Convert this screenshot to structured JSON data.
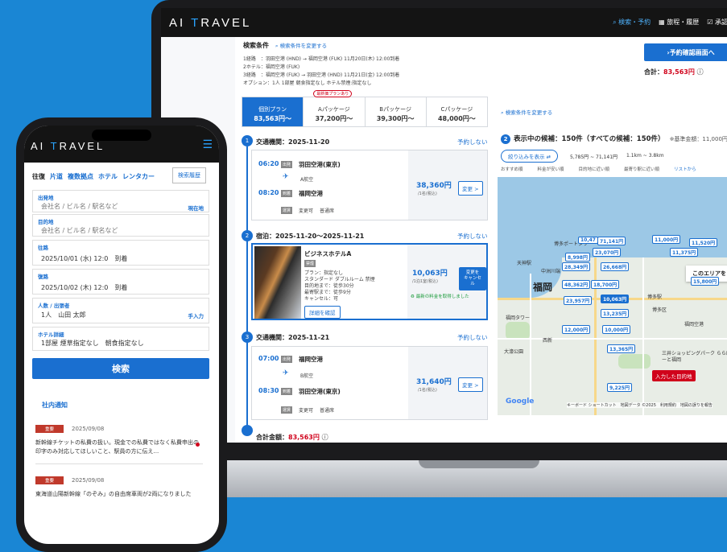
{
  "brand": {
    "name_prefix": "AI ",
    "name_t": "T",
    "name_suffix": "RAVEL"
  },
  "laptop": {
    "nav": [
      {
        "label": "検索・予約"
      },
      {
        "label": "旅程・履歴"
      },
      {
        "label": "承認"
      }
    ],
    "criteria": {
      "title": "検索条件",
      "change_link": "検索条件を変更する",
      "lines": [
        "1経路　：羽田空港 (HND) → 福岡空港 (FUK) 11月20日(木) 12:00到着",
        "2ホテル：福岡空港 (FUK)",
        "3経路　：福岡空港 (FUK) → 羽田空港 (HND) 11月21日(金) 12:00到着",
        "オプション：1人 1部屋 朝食指定なし ホテル禁煙:指定なし"
      ]
    },
    "confirm_button": "予約確認画面へ",
    "total_label": "合計：",
    "total_value": "83,563円",
    "plan_tabs": [
      {
        "label": "個別プラン",
        "price": "83,563円〜"
      },
      {
        "label": "Aパッケージ",
        "price": "37,200円〜",
        "badge": "最新価プランあり"
      },
      {
        "label": "Bパッケージ",
        "price": "39,300円〜"
      },
      {
        "label": "Cパッケージ",
        "price": "48,000円〜"
      }
    ],
    "sections": [
      {
        "num": "1",
        "title": "交通機関：2025-11-20",
        "link": "予約しない",
        "dep_time": "06:20",
        "dep_tag": "出発",
        "dep_place": "羽田空港(東京)",
        "carrier": "A航空",
        "arr_time": "08:20",
        "arr_tag": "到着",
        "arr_place": "福岡空港",
        "fare_tag": "運賃",
        "fare_1": "変更可",
        "fare_2": "普通席",
        "price": "38,360円",
        "per": "/1名(税込)",
        "change": "変更 >"
      },
      {
        "num": "2",
        "title": "宿泊：2025-11-20〜2025-11-21",
        "link": "予約しない",
        "hotel_name": "ビジネスホテルA",
        "hotel_tag": "禁煙",
        "details": [
          "プラン：指定なし",
          "スタンダード ダブルルーム 禁煙",
          "目的地まで：徒歩30分",
          "最寄駅まで：徒歩9分",
          "キャンセル：可"
        ],
        "detail_button": "詳細を確認",
        "price": "10,063円",
        "per": "/1泊1室(税込)",
        "change_line1": "変更を",
        "change_line2": "キャンセル",
        "latest": "最新の料金を取得しました"
      },
      {
        "num": "3",
        "title": "交通機関：2025-11-21",
        "link": "予約しない",
        "dep_time": "07:00",
        "dep_tag": "出発",
        "dep_place": "福岡空港",
        "carrier": "B航空",
        "arr_time": "08:30",
        "arr_tag": "到着",
        "arr_place": "羽田空港(東京)",
        "fare_tag": "運賃",
        "fare_1": "変更可",
        "fare_2": "普通席",
        "price": "31,640円",
        "per": "/1名(税込)",
        "change": "変更 >"
      }
    ],
    "grand_total_label": "合計金額：",
    "grand_total_value": "83,563円",
    "map_panel": {
      "change_link": "検索条件を変更する",
      "num": "2",
      "heading": "表示中の候補：150件（すべての候補：150件）",
      "sub": "※基準金額：11,000円",
      "filter_button": "絞り込みを表示",
      "price_range": "5,785円 ~ 71,141円",
      "distance_range": "1.1km ~ 3.8km",
      "sort_tabs": [
        "おすすめ順",
        "料金が安い順",
        "目的地に近い順",
        "最寄り駅に近い順",
        "リストから"
      ],
      "area_search": "このエリアを",
      "dest_pin": "入力した目的地",
      "city": "福岡",
      "labels": [
        "博多区",
        "天神駅",
        "中洲川端",
        "西新",
        "博多駅",
        "福岡空港",
        "三井ショッピングパーク ららぽーと福岡",
        "大濠公園",
        "福岡タワー",
        "博多ポートタワー"
      ],
      "prices": [
        "11,520円",
        "10,47",
        "71,141円",
        "11,000円",
        "23,070円",
        "8,998円",
        "26,668円",
        "28,349円",
        "48,362円",
        "18,700円",
        "23,957円",
        "10,063円",
        "13,235円",
        "10,000円",
        "15,800円",
        "13,365円",
        "12,000円",
        "9,225円",
        "11,375円"
      ],
      "google": "Google",
      "attribution": "キーボード ショートカット　地図データ ©2025　利用規約　地図の誤りを報告"
    }
  },
  "phone": {
    "tabs": [
      "往復",
      "片道",
      "複数拠点",
      "ホテル",
      "レンタカー"
    ],
    "history_button": "検索履歴",
    "fields": [
      {
        "label": "出発地",
        "value": "会社名 / ビル名 / 駅名など",
        "action": "現在地",
        "placeholder": true
      },
      {
        "label": "目的地",
        "value": "会社名 / ビル名 / 駅名など",
        "action": "",
        "placeholder": true
      },
      {
        "label": "往路",
        "value": "2025/10/01 (水) 12:0　到着",
        "action": ""
      },
      {
        "label": "復路",
        "value": "2025/10/02 (木) 12:0　到着",
        "action": ""
      },
      {
        "label": "人数 / 出張者",
        "value": "1人　山田 太郎",
        "action": "手入力"
      },
      {
        "label": "ホテル詳細",
        "value": "1部屋 煙草指定なし　朝食指定なし",
        "action": ""
      }
    ],
    "search_button": "検索",
    "notice_heading": "社内通知",
    "notices": [
      {
        "badge": "重要",
        "date": "2025/09/08",
        "body": "新幹線チケットの私費の扱い。現金での私費ではなく私費申出の印字のみ対応してほしいこと、駅員の方に伝え..."
      },
      {
        "badge": "重要",
        "date": "2025/09/08",
        "body": "東海道山陽新幹線「のぞみ」の自由席車両が2両になりました"
      }
    ]
  }
}
